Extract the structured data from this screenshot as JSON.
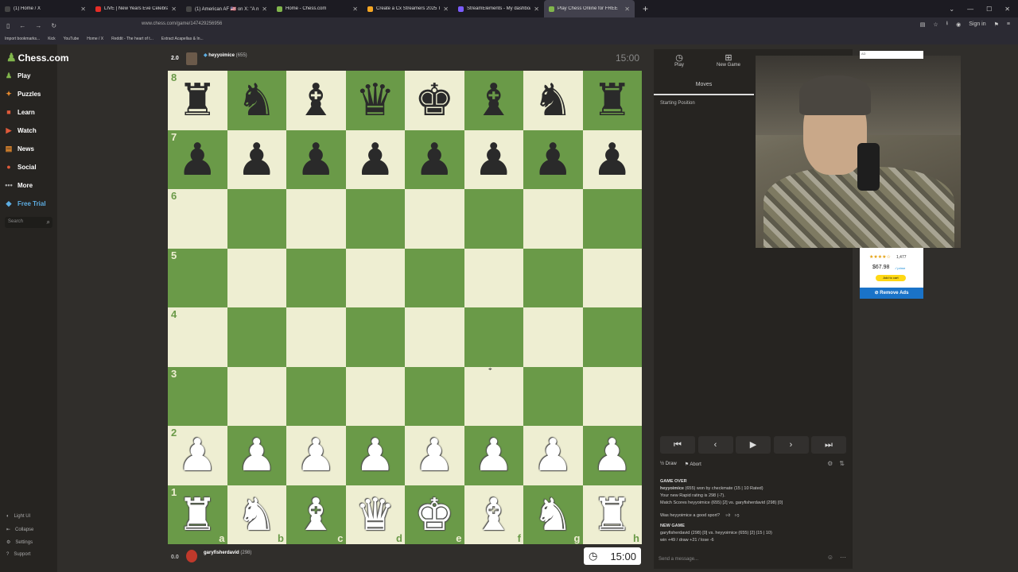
{
  "browser": {
    "tabs": [
      {
        "title": "(1) Home / X",
        "color": "#444"
      },
      {
        "title": "LIVE | New Years Eve Celebratio",
        "color": "#e52d27"
      },
      {
        "title": "(1) American AF 🇺🇸 on X: \"A mo",
        "color": "#444"
      },
      {
        "title": "Home - Chess.com",
        "color": "#81b64c"
      },
      {
        "title": "Create a Cx Streamers 2025 Tie",
        "color": "#f5a623"
      },
      {
        "title": "StreamElements - My dashboar",
        "color": "#7b5cff"
      },
      {
        "title": "Play Chess Online for FREE",
        "color": "#81b64c"
      }
    ],
    "url": "www.chess.com/game/147429256956",
    "sign_in": "Sign in",
    "bookmarks": [
      "Import bookmarks...",
      "Kick",
      "YouTube",
      "Home / X",
      "Reddit - The heart of t...",
      "Extract Acapellas & In..."
    ]
  },
  "sidebar": {
    "logo": "Chess.com",
    "items": [
      {
        "label": "Play",
        "icon": "play-icon",
        "glyph": "♟",
        "color": "#81b64c"
      },
      {
        "label": "Puzzles",
        "icon": "puzzle-icon",
        "glyph": "✦",
        "color": "#e68a2e"
      },
      {
        "label": "Learn",
        "icon": "learn-icon",
        "glyph": "■",
        "color": "#e05a3a"
      },
      {
        "label": "Watch",
        "icon": "watch-icon",
        "glyph": "▶",
        "color": "#e05a3a"
      },
      {
        "label": "News",
        "icon": "news-icon",
        "glyph": "▤",
        "color": "#e68a2e"
      },
      {
        "label": "Social",
        "icon": "social-icon",
        "glyph": "●",
        "color": "#e05a3a"
      },
      {
        "label": "More",
        "icon": "more-icon",
        "glyph": "•••",
        "color": "#aaa"
      },
      {
        "label": "Free Trial",
        "icon": "diamond-icon",
        "glyph": "◆",
        "color": "#5dade2"
      }
    ],
    "search_placeholder": "Search",
    "bottom": [
      "Light UI",
      "Collapse",
      "Settings",
      "Support"
    ]
  },
  "top_player": {
    "eval": "2.0",
    "name": "heyyoimice",
    "rating": "(655)",
    "clock": "15:00"
  },
  "bottom_player": {
    "eval": "0.0",
    "name": "garyfisherdavid",
    "rating": "(298)",
    "clock": "15:00"
  },
  "board": {
    "ranks": [
      "8",
      "7",
      "6",
      "5",
      "4",
      "3",
      "2",
      "1"
    ],
    "files": [
      "a",
      "b",
      "c",
      "d",
      "e",
      "f",
      "g",
      "h"
    ],
    "position": [
      [
        "br",
        "bn",
        "bb",
        "bq",
        "bk",
        "bb",
        "bn",
        "br"
      ],
      [
        "bp",
        "bp",
        "bp",
        "bp",
        "bp",
        "bp",
        "bp",
        "bp"
      ],
      [
        "",
        "",
        "",
        "",
        "",
        "",
        "",
        ""
      ],
      [
        "",
        "",
        "",
        "",
        "",
        "",
        "",
        ""
      ],
      [
        "",
        "",
        "",
        "",
        "",
        "",
        "",
        ""
      ],
      [
        "",
        "",
        "",
        "",
        "",
        "",
        "",
        ""
      ],
      [
        "wp",
        "wp",
        "wp",
        "wp",
        "wp",
        "wp",
        "wp",
        "wp"
      ],
      [
        "wr",
        "wn",
        "wb",
        "wq",
        "wk",
        "wb",
        "wn",
        "wr"
      ]
    ]
  },
  "panel": {
    "tabs": [
      "Play",
      "New Game"
    ],
    "moves_tab": "Moves",
    "starting_position": "Starting Position",
    "draw": "Draw",
    "abort": "Abort",
    "log": {
      "game_over": "GAME OVER",
      "result_name": "heyyoimice",
      "result_rest": "(655) won by checkmate (15 | 10 Rated)",
      "rating_change": "Your new Rapid rating is 298 (-7).",
      "match_scores": "Match Scores heyyoimice (655) [2] vs. garyfisherdavid (298) [0]",
      "good_sport": "Was heyyoimice a good sport?",
      "new_game": "NEW GAME",
      "new_game_line": "garyfisherdavid (298) [0] vs. heyyoimice (655) [2] (15 | 10)",
      "win_line": "win +49 / draw +21 / lose -6"
    },
    "message_placeholder": "Send a message..."
  },
  "ad": {
    "tag": "AD",
    "stars": "★★★★☆",
    "count": "1,477",
    "price": "$67.98",
    "prime": "✓prime",
    "cart": "Add to cart",
    "remove": "Remove Ads"
  }
}
